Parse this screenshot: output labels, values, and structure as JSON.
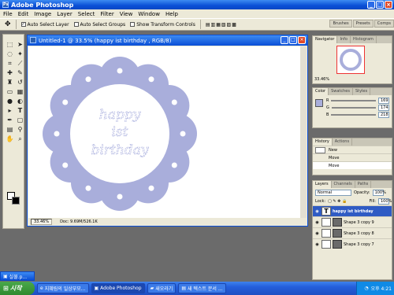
{
  "app": {
    "title": "Adobe Photoshop"
  },
  "menu": [
    "File",
    "Edit",
    "Image",
    "Layer",
    "Select",
    "Filter",
    "View",
    "Window",
    "Help"
  ],
  "options": {
    "auto_select_layer": "Auto Select Layer",
    "auto_select_groups": "Auto Select Groups",
    "show_transform_controls": "Show Transform Controls"
  },
  "palette_well": [
    "Brushes",
    "Presets",
    "Comps"
  ],
  "document": {
    "title": "Untitled-1 @ 33.5% (happy ist birthday , RGB/8)",
    "text_lines": [
      "happy",
      "ist",
      "birthday"
    ],
    "status_zoom": "33.46%",
    "status_doc": "Doc: 9.69M/526.1K"
  },
  "navigator": {
    "tabs": [
      "Navigator",
      "Info",
      "Histogram"
    ],
    "zoom": "33.46%"
  },
  "color": {
    "tabs": [
      "Color",
      "Swatches",
      "Styles"
    ],
    "channels": [
      {
        "label": "R",
        "value": "169"
      },
      {
        "label": "G",
        "value": "174"
      },
      {
        "label": "B",
        "value": "218"
      }
    ]
  },
  "history": {
    "tabs": [
      "History",
      "Actions"
    ],
    "items": [
      "New",
      "Move",
      "Move"
    ]
  },
  "layers": {
    "tabs": [
      "Layers",
      "Channels",
      "Paths"
    ],
    "blend_mode": "Normal",
    "opacity_label": "Opacity:",
    "opacity": "100%",
    "lock_label": "Lock:",
    "fill_label": "Fill:",
    "fill": "100%",
    "items": [
      "happy ist birthday",
      "Shape 3 copy 9",
      "Shape 3 copy 8",
      "Shape 3 copy 7"
    ]
  },
  "taskbar": {
    "start": "시작",
    "floating": "실물.p...",
    "tasks": [
      "지혜림의 일상부모...",
      "Adobe Photoshop",
      "새오라기",
      "새 텍스트 문서 ..."
    ],
    "time": "오후 4:21"
  },
  "colors": {
    "scallop": "#a9aedb",
    "accent_blue": "#0a4fd6"
  }
}
